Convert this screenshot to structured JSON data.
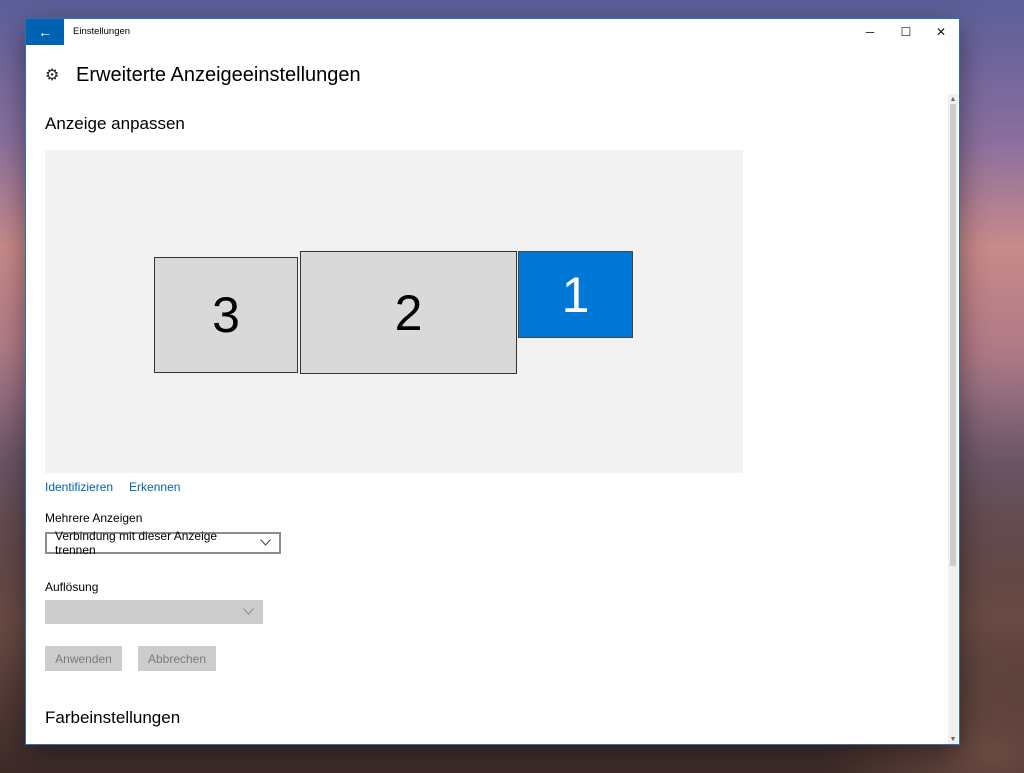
{
  "window": {
    "title": "Einstellungen",
    "back_icon": "←",
    "minimize_icon": "─",
    "maximize_icon": "☐",
    "close_icon": "✕"
  },
  "page": {
    "title": "Erweiterte Anzeigeeinstellungen",
    "gear_icon": "⚙"
  },
  "customize": {
    "title": "Anzeige anpassen",
    "monitors": [
      {
        "number": "3",
        "selected": false
      },
      {
        "number": "2",
        "selected": false
      },
      {
        "number": "1",
        "selected": true
      }
    ],
    "identify_link": "Identifizieren",
    "detect_link": "Erkennen"
  },
  "multiple_displays": {
    "label": "Mehrere Anzeigen",
    "selected": "Verbindung mit dieser Anzeige trennen"
  },
  "resolution": {
    "label": "Auflösung",
    "selected": ""
  },
  "buttons": {
    "apply": "Anwenden",
    "cancel": "Abbrechen"
  },
  "color_settings": {
    "title": "Farbeinstellungen"
  },
  "colors": {
    "accent": "#0078d7",
    "link": "#0063b1",
    "titlebar_back": "#0063b1"
  }
}
